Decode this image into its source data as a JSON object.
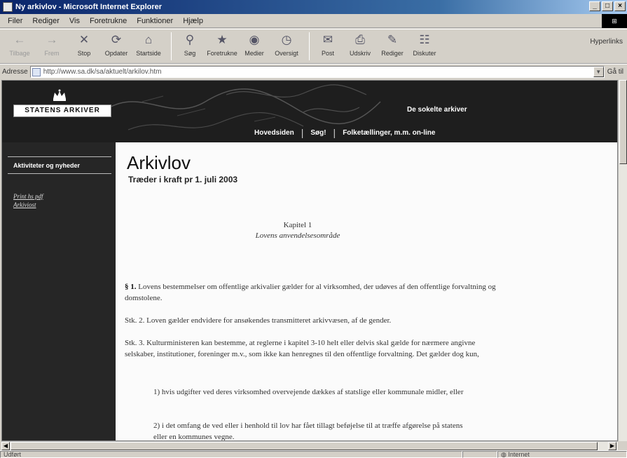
{
  "window": {
    "title": "Ny arkivlov - Microsoft Internet Explorer",
    "controls": [
      "_",
      "□",
      "×"
    ]
  },
  "menu": {
    "items": [
      "Filer",
      "Rediger",
      "Vis",
      "Foretrukne",
      "Funktioner",
      "Hjælp"
    ]
  },
  "toolbar": {
    "buttons": [
      {
        "label": "Tilbage",
        "icon": "back-arrow-icon",
        "glyph": "←",
        "disabled": true
      },
      {
        "label": "Frem",
        "icon": "forward-arrow-icon",
        "glyph": "→",
        "disabled": true
      },
      {
        "label": "Stop",
        "icon": "stop-icon",
        "glyph": "✕",
        "disabled": false
      },
      {
        "label": "Opdater",
        "icon": "refresh-icon",
        "glyph": "⟳",
        "disabled": false
      },
      {
        "label": "Startside",
        "icon": "home-icon",
        "glyph": "⌂",
        "disabled": false
      },
      {
        "label": "Søg",
        "icon": "search-icon",
        "glyph": "⚲",
        "disabled": false
      },
      {
        "label": "Foretrukne",
        "icon": "favorites-icon",
        "glyph": "★",
        "disabled": false
      },
      {
        "label": "Medier",
        "icon": "media-icon",
        "glyph": "◉",
        "disabled": false
      },
      {
        "label": "Oversigt",
        "icon": "history-icon",
        "glyph": "◷",
        "disabled": false
      },
      {
        "label": "Post",
        "icon": "mail-icon",
        "glyph": "✉",
        "disabled": false
      },
      {
        "label": "Udskriv",
        "icon": "print-icon",
        "glyph": "⎙",
        "disabled": false
      },
      {
        "label": "Rediger",
        "icon": "edit-icon",
        "glyph": "✎",
        "disabled": false
      },
      {
        "label": "Diskuter",
        "icon": "discuss-icon",
        "glyph": "☷",
        "disabled": false
      }
    ],
    "links_label": "Hyperlinks"
  },
  "address": {
    "label": "Adresse",
    "url": "http://www.sa.dk/sa/aktuelt/arkilov.htm",
    "go_label": "Gå til"
  },
  "page": {
    "logo_text": "STATENS ARKIVER",
    "site_tag": "De sokelte arkiver",
    "nav": [
      "Hovedsiden",
      "Søg!",
      "Folketællinger, m.m. on-line"
    ],
    "sidebar": {
      "heading": "Aktiviteter og nyheder",
      "links": [
        "Print hs pdf",
        "Arkiviost"
      ]
    },
    "title": "Arkivlov",
    "subtitle": "Træder i kraft pr 1. juli 2003",
    "chapter_label": "Kapitel 1",
    "chapter_name": "Lovens anvendelsesområde",
    "paragraphs": [
      {
        "lead": "§ 1.",
        "text": " Lovens bestemmelser om offentlige arkivalier gælder for al virksomhed, der udøves af den offentlige forvaltning og domstolene."
      },
      {
        "lead": "",
        "text": "Stk. 2. Loven gælder endvidere for ansøkendes transmitteret arkivvæsen, af de gender."
      },
      {
        "lead": "",
        "text": "Stk. 3. Kulturministeren kan bestemme, at reglerne i kapitel 3-10 helt eller delvis skal gælde for nærmere angivne selskaber, institutioner, foreninger m.v., som ikke kan henregnes til den offentlige forvaltning. Det gælder dog kun,"
      },
      {
        "lead": "",
        "text": "1) hvis udgifter ved deres virksomhed overvejende dækkes af statslige eller kommunale midler, eller",
        "indent": true
      },
      {
        "lead": "",
        "text": "2) i det omfang de ved eller i henhold til lov har fået tillagt beføjelse til at træffe afgørelse på statens eller en kommunes vegne.",
        "indent": true
      }
    ]
  },
  "status": {
    "text": "Udført",
    "zone": "Internet"
  }
}
